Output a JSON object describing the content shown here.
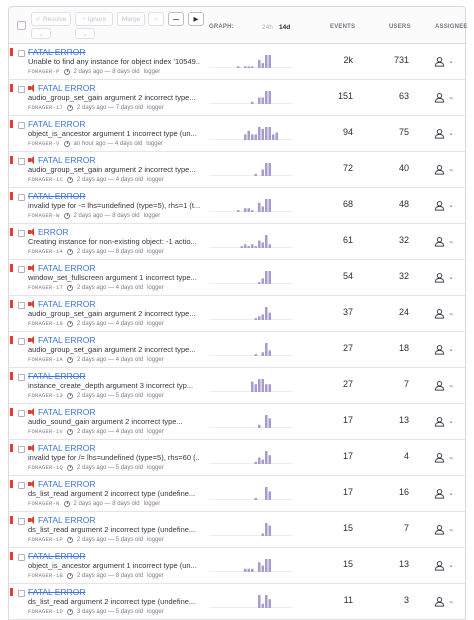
{
  "toolbar": {
    "resolve_label": "Resolve",
    "ignore_label": "Ignore",
    "merge_label": "Merge",
    "bookmark_icon": "star-icon",
    "minus_icon": "minus-icon",
    "play_icon": "play-icon"
  },
  "columns": {
    "graph": "GRAPH:",
    "range_24h": "24h",
    "range_14d": "14d",
    "events": "EVENTS",
    "users": "USERS",
    "assignee": "ASSIGNEE"
  },
  "colors": {
    "link": "#3d74db",
    "level_fatal": "#e03e2f",
    "bar": "#a89bcf"
  },
  "issues": [
    {
      "title": "FATAL ERROR",
      "strike": true,
      "icon": false,
      "message": "Unable to find any instance for object index '10549...",
      "short_id": "FORAGER-P",
      "age": "2 days ago — 8 days old",
      "logger": "logger",
      "events": "2k",
      "users": "731",
      "bars": [
        0,
        0,
        0,
        0,
        0,
        0,
        0,
        0,
        1,
        0,
        1,
        1,
        1,
        0,
        5,
        3,
        8,
        8,
        0,
        0,
        0,
        0,
        0,
        0
      ]
    },
    {
      "title": "FATAL ERROR",
      "strike": false,
      "icon": true,
      "message": "audio_group_set_gain argument 2 incorrect type...",
      "short_id": "FORAGER-17",
      "age": "2 days ago — 7 days old",
      "logger": "logger",
      "events": "151",
      "users": "63",
      "bars": [
        0,
        0,
        0,
        0,
        0,
        0,
        0,
        0,
        0,
        0,
        0,
        0,
        1,
        0,
        3,
        3,
        6,
        6,
        0,
        0,
        0,
        0,
        0,
        0
      ]
    },
    {
      "title": "FATAL ERROR",
      "strike": false,
      "icon": false,
      "message": "object_is_ancestor argument 1 incorrect type (un...",
      "short_id": "FORAGER-V",
      "age": "an hour ago — 4 days old",
      "logger": "logger",
      "events": "94",
      "users": "75",
      "bars": [
        0,
        0,
        0,
        0,
        0,
        0,
        0,
        0,
        0,
        0,
        3,
        5,
        3,
        3,
        7,
        6,
        7,
        7,
        3,
        4,
        0,
        0,
        0,
        0
      ]
    },
    {
      "title": "FATAL ERROR",
      "strike": false,
      "icon": true,
      "message": "audio_group_set_gain argument 2 incorrect type...",
      "short_id": "FORAGER-1C",
      "age": "2 days ago — 4 days old",
      "logger": "logger",
      "events": "72",
      "users": "40",
      "bars": [
        0,
        0,
        0,
        0,
        0,
        0,
        0,
        0,
        0,
        0,
        0,
        0,
        0,
        1,
        0,
        3,
        6,
        6,
        0,
        0,
        0,
        0,
        0,
        0
      ]
    },
    {
      "title": "FATAL ERROR",
      "strike": true,
      "icon": false,
      "message": "invalid type for -= lhs=undefined (type=5), rhs=1 (t...",
      "short_id": "FORAGER-W",
      "age": "2 days ago — 8 days old",
      "logger": "logger",
      "events": "68",
      "users": "48",
      "bars": [
        0,
        0,
        0,
        0,
        0,
        0,
        0,
        0,
        1,
        0,
        2,
        2,
        1,
        0,
        5,
        3,
        7,
        7,
        0,
        0,
        0,
        0,
        0,
        0
      ]
    },
    {
      "title": "ERROR",
      "strike": false,
      "icon": true,
      "message": "Creating instance for non-existing object: -1 actio...",
      "short_id": "FORAGER-14",
      "age": "2 days ago — 8 days old",
      "logger": "logger",
      "events": "61",
      "users": "32",
      "bars": [
        0,
        0,
        0,
        0,
        0,
        0,
        0,
        0,
        0,
        1,
        2,
        1,
        2,
        1,
        4,
        3,
        7,
        2,
        0,
        0,
        0,
        0,
        0,
        0
      ]
    },
    {
      "title": "FATAL ERROR",
      "strike": false,
      "icon": true,
      "message": "window_set_fullscreen argument 1 incorrect type...",
      "short_id": "FORAGER-1T",
      "age": "2 days ago — 4 days old",
      "logger": "logger",
      "events": "54",
      "users": "32",
      "bars": [
        0,
        0,
        0,
        0,
        0,
        0,
        0,
        0,
        0,
        0,
        0,
        0,
        0,
        0,
        1,
        3,
        7,
        7,
        0,
        0,
        0,
        0,
        0,
        0
      ]
    },
    {
      "title": "FATAL ERROR",
      "strike": false,
      "icon": true,
      "message": "audio_group_set_gain argument 2 incorrect type...",
      "short_id": "FORAGER-18",
      "age": "2 days ago — 4 days old",
      "logger": "logger",
      "events": "37",
      "users": "24",
      "bars": [
        0,
        0,
        0,
        0,
        0,
        0,
        0,
        0,
        0,
        0,
        0,
        0,
        0,
        1,
        2,
        3,
        7,
        4,
        0,
        0,
        0,
        0,
        0,
        0
      ]
    },
    {
      "title": "FATAL ERROR",
      "strike": false,
      "icon": true,
      "message": "audio_group_set_gain argument 2 incorrect type...",
      "short_id": "FORAGER-1A",
      "age": "2 days ago — 4 days old",
      "logger": "logger",
      "events": "27",
      "users": "18",
      "bars": [
        0,
        0,
        0,
        0,
        0,
        0,
        0,
        0,
        0,
        0,
        0,
        0,
        0,
        1,
        0,
        2,
        7,
        3,
        0,
        0,
        0,
        0,
        0,
        0
      ]
    },
    {
      "title": "FATAL ERROR",
      "strike": true,
      "icon": false,
      "message": "instance_create_depth argument 3 incorrect typ...",
      "short_id": "FORAGER-13",
      "age": "2 days ago — 5 days old",
      "logger": "logger",
      "events": "27",
      "users": "7",
      "bars": [
        0,
        0,
        0,
        0,
        0,
        0,
        0,
        0,
        0,
        0,
        0,
        0,
        4,
        3,
        5,
        5,
        3,
        3,
        0,
        0,
        0,
        0,
        0,
        0
      ]
    },
    {
      "title": "FATAL ERROR",
      "strike": false,
      "icon": true,
      "message": "audio_sound_gain argument 2 incorrect type...",
      "short_id": "FORAGER-1V",
      "age": "2 days ago — 4 days old",
      "logger": "logger",
      "events": "17",
      "users": "13",
      "bars": [
        0,
        0,
        0,
        0,
        0,
        0,
        0,
        0,
        0,
        0,
        0,
        0,
        0,
        0,
        1,
        0,
        4,
        3,
        0,
        0,
        0,
        0,
        0,
        0
      ]
    },
    {
      "title": "FATAL ERROR",
      "strike": false,
      "icon": true,
      "message": "invalid type for /= lhs=undefined (type=5), rhs=60 (...",
      "short_id": "FORAGER-1Q",
      "age": "2 days ago — 5 days old",
      "logger": "logger",
      "events": "17",
      "users": "4",
      "bars": [
        0,
        0,
        0,
        0,
        0,
        0,
        0,
        0,
        0,
        0,
        0,
        0,
        0,
        1,
        3,
        2,
        6,
        4,
        0,
        0,
        0,
        0,
        0,
        0
      ]
    },
    {
      "title": "FATAL ERROR",
      "strike": false,
      "icon": true,
      "message": "ds_list_read argument 2 incorrect type (undefine...",
      "short_id": "FORAGER-N",
      "age": "2 days ago — 8 days old",
      "logger": "logger",
      "events": "17",
      "users": "16",
      "bars": [
        0,
        0,
        0,
        0,
        0,
        0,
        0,
        0,
        0,
        0,
        0,
        0,
        0,
        1,
        0,
        0,
        6,
        4,
        0,
        0,
        0,
        0,
        0,
        0
      ]
    },
    {
      "title": "FATAL ERROR",
      "strike": false,
      "icon": true,
      "message": "ds_list_read argument 2 incorrect type (undefine...",
      "short_id": "FORAGER-1P",
      "age": "2 days ago — 5 days old",
      "logger": "logger",
      "events": "15",
      "users": "7",
      "bars": [
        0,
        0,
        0,
        0,
        0,
        0,
        0,
        0,
        0,
        0,
        0,
        0,
        0,
        0,
        0,
        1,
        5,
        4,
        0,
        0,
        0,
        0,
        0,
        0
      ]
    },
    {
      "title": "FATAL ERROR",
      "strike": true,
      "icon": false,
      "message": "object_is_ancestor argument 1 incorrect type (un...",
      "short_id": "FORAGER-1B",
      "age": "2 days ago — 8 days old",
      "logger": "logger",
      "events": "15",
      "users": "13",
      "bars": [
        0,
        0,
        0,
        0,
        0,
        0,
        0,
        0,
        0,
        0,
        1,
        1,
        1,
        0,
        3,
        2,
        4,
        4,
        0,
        0,
        0,
        0,
        0,
        0
      ]
    },
    {
      "title": "FATAL ERROR",
      "strike": true,
      "icon": false,
      "message": "ds_list_read argument 2 incorrect type (undefine...",
      "short_id": "FORAGER-1D",
      "age": "3 days ago — 5 days old",
      "logger": "logger",
      "events": "11",
      "users": "3",
      "bars": [
        0,
        0,
        0,
        0,
        0,
        0,
        0,
        0,
        0,
        0,
        0,
        0,
        0,
        0,
        3,
        1,
        3,
        2,
        0,
        0,
        0,
        0,
        0,
        0
      ]
    }
  ]
}
